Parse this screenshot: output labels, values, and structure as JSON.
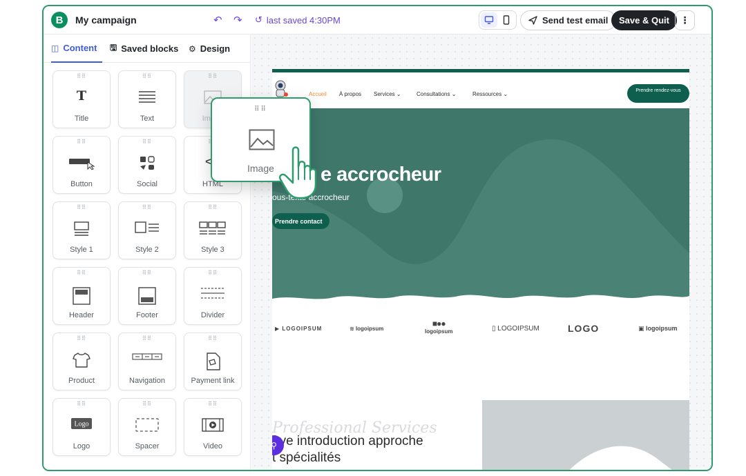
{
  "header": {
    "logo_letter": "B",
    "title": "My campaign",
    "last_saved": "last saved 4:30PM",
    "send_test_label": "Send test email",
    "save_quit_label": "Save & Quit"
  },
  "sidebar": {
    "tabs": [
      {
        "label": "Content",
        "active": true
      },
      {
        "label": "Saved blocks",
        "active": false
      },
      {
        "label": "Design",
        "active": false
      }
    ],
    "blocks": [
      {
        "label": "Title",
        "icon": "title-icon"
      },
      {
        "label": "Text",
        "icon": "text-icon"
      },
      {
        "label": "Image",
        "icon": "image-icon"
      },
      {
        "label": "Button",
        "icon": "button-icon"
      },
      {
        "label": "Social",
        "icon": "social-icon"
      },
      {
        "label": "HTML",
        "icon": "html-icon"
      },
      {
        "label": "Style 1",
        "icon": "style1-icon"
      },
      {
        "label": "Style 2",
        "icon": "style2-icon"
      },
      {
        "label": "Style 3",
        "icon": "style3-icon"
      },
      {
        "label": "Header",
        "icon": "header-icon"
      },
      {
        "label": "Footer",
        "icon": "footer-icon"
      },
      {
        "label": "Divider",
        "icon": "divider-icon"
      },
      {
        "label": "Product",
        "icon": "product-icon"
      },
      {
        "label": "Navigation",
        "icon": "navigation-icon"
      },
      {
        "label": "Payment link",
        "icon": "payment-link-icon"
      },
      {
        "label": "Logo",
        "icon": "logo-icon"
      },
      {
        "label": "Spacer",
        "icon": "spacer-icon"
      },
      {
        "label": "Video",
        "icon": "video-icon"
      }
    ]
  },
  "drag_ghost": {
    "label": "Image"
  },
  "email": {
    "nav": [
      "Accueil",
      "À propos",
      "Services",
      "Consultations",
      "Ressources"
    ],
    "nav_cta": "Prendre rendez-vous",
    "hero_title": "e accrocheur",
    "hero_subtitle": "ous-texte accrocheur",
    "hero_button": "Prendre contact",
    "logos": [
      "LOGOIPSUM",
      "logoipsum",
      "logoipsum",
      "LOGOIPSUM",
      "LOGO",
      "logoipsum"
    ],
    "section_script": "Professional Services",
    "intro_line1": "ève introduction approche",
    "intro_line2": "t spécialités"
  },
  "colors": {
    "brand": "#0b8f5e",
    "accent": "#6a45d6",
    "hero": "#4a8275",
    "cta": "#0f5f4e"
  }
}
